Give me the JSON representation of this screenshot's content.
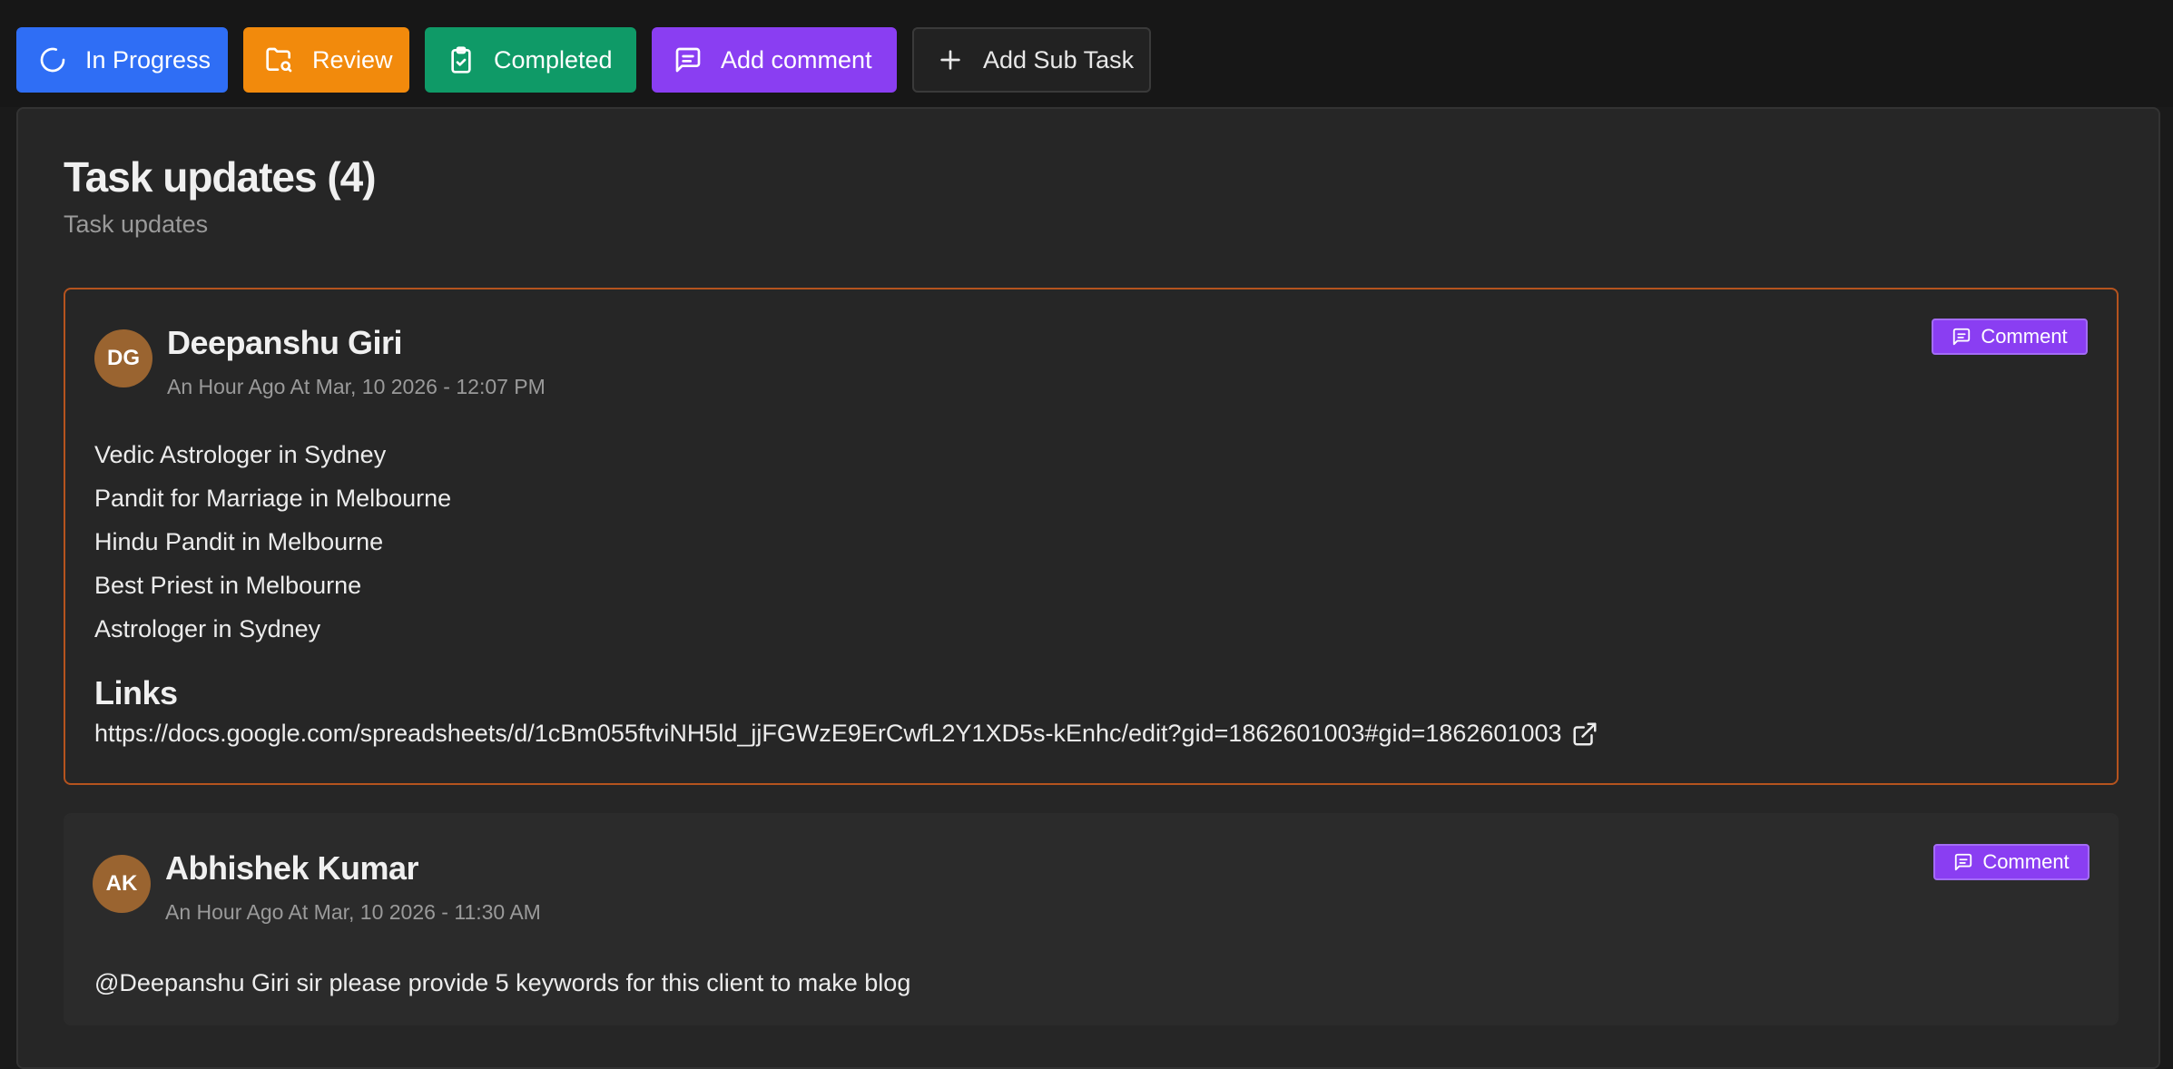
{
  "toolbar": {
    "in_progress_label": "In Progress",
    "review_label": "Review",
    "completed_label": "Completed",
    "add_comment_label": "Add comment",
    "add_subtask_label": "Add Sub Task"
  },
  "panel": {
    "title": "Task updates (4)",
    "subtitle": "Task updates"
  },
  "updates": [
    {
      "initials": "DG",
      "author": "Deepanshu Giri",
      "time": "An Hour Ago At Mar, 10 2026 - 12:07 PM",
      "badge": "Comment",
      "lines": [
        "Vedic Astrologer in Sydney",
        "Pandit for Marriage in Melbourne",
        "Hindu Pandit in Melbourne",
        "Best Priest in Melbourne",
        "Astrologer in Sydney"
      ],
      "links_title": "Links",
      "link": "https://docs.google.com/spreadsheets/d/1cBm055ftviNH5ld_jjFGWzE9ErCwfL2Y1XD5s-kEnhc/edit?gid=1862601003#gid=1862601003"
    },
    {
      "initials": "AK",
      "author": "Abhishek Kumar",
      "time": "An Hour Ago At Mar, 10 2026 - 11:30 AM",
      "badge": "Comment",
      "message": "@Deepanshu Giri sir please provide 5 keywords for this client to make blog"
    }
  ],
  "colors": {
    "in_progress": "#2f6ef5",
    "review": "#f28a0c",
    "completed": "#0f9a67",
    "comment": "#8a3ef2",
    "highlight_border": "#b5531e",
    "avatar": "#9a6430"
  },
  "icons": {
    "in_progress": "loader-icon",
    "review": "folder-search-icon",
    "completed": "clipboard-check-icon",
    "add_comment": "message-square-icon",
    "add_subtask": "plus-icon",
    "link": "external-link-icon"
  }
}
